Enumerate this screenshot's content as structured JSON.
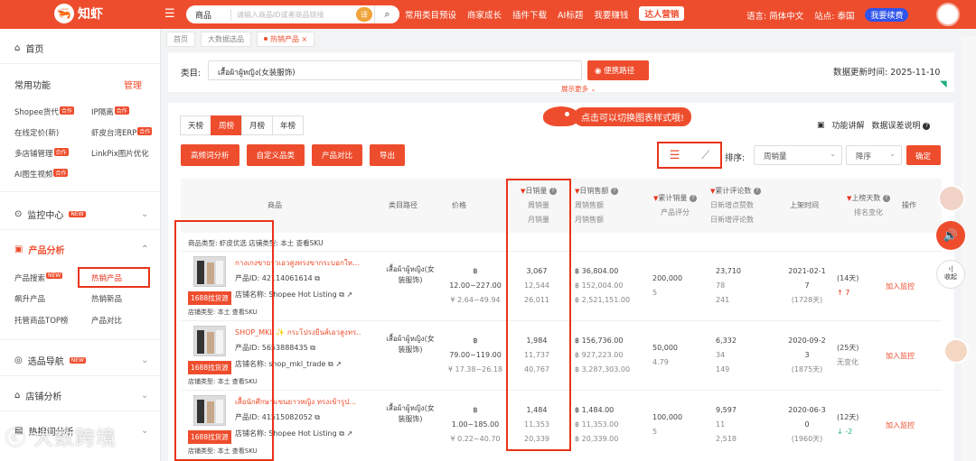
{
  "topbar": {
    "logo": "知虾",
    "search_type": "商品",
    "search_placeholder": "请输入商品ID或者商品链接",
    "translate_label": "译",
    "nav": [
      "常用类目预设",
      "商家成长",
      "插件下载",
      "AI标题",
      "我要赚钱"
    ],
    "sales_button": "达人营销",
    "language": "语言: 简体中文",
    "site": "站点: 泰国",
    "renew": "我要续费"
  },
  "sidebar": {
    "home": "首页",
    "common": "常用功能",
    "manage": "管理",
    "tools": [
      {
        "label": "Shopee货代",
        "tag": "合作"
      },
      {
        "label": "IP隔离",
        "tag": "合作"
      },
      {
        "label": "在线定价(新)",
        "tag": ""
      },
      {
        "label": "虾皮台湾ERP",
        "tag": "合作"
      },
      {
        "label": "多店铺管理",
        "tag": "合作"
      },
      {
        "label": "LinkPix图片优化",
        "tag": ""
      },
      {
        "label": "AI图生视频",
        "tag": "合作"
      }
    ],
    "monitor": "监控中心",
    "monitor_tag": "NEW",
    "product_analysis": "产品分析",
    "product_subs": [
      {
        "label": "产品搜索",
        "tag": "NEW"
      },
      {
        "label": "热销产品",
        "tag": ""
      },
      {
        "label": "飙升产品",
        "tag": ""
      },
      {
        "label": "热销新品",
        "tag": ""
      },
      {
        "label": "托管商品TOP榜",
        "tag": ""
      },
      {
        "label": "产品对比",
        "tag": ""
      }
    ],
    "selection": "选品导航",
    "selection_tag": "NEW",
    "shop_analysis": "店铺分析",
    "keyword_analysis": "热搜词分析",
    "watermark": "大数跨境"
  },
  "tabs": [
    "首页",
    "大数据选品",
    "热销产品"
  ],
  "category": {
    "label": "类目:",
    "value": "เสื้อผ้าผู้หญิง(女装服饰)",
    "shortcut": "便携路径",
    "update_label": "数据更新时间: 2025-11-10",
    "more": "展示更多"
  },
  "controls": {
    "periods": [
      "天榜",
      "周榜",
      "月榜",
      "年榜"
    ],
    "active_period": "周榜",
    "actions": [
      "高频词分析",
      "自定义品类",
      "产品对比",
      "导出"
    ],
    "tip": "点击可以切换图表样式哦!",
    "explain": "功能讲解",
    "error_note": "数据误差说明",
    "sort_label": "排序:",
    "sort_value": "周销量",
    "order_value": "降序",
    "confirm": "确定"
  },
  "table": {
    "headers": {
      "product": "商品",
      "path": "类目路径",
      "price": "价格",
      "sales": [
        "日销量",
        "周销量",
        "月销量"
      ],
      "revenue": [
        "日销售额",
        "周销售额",
        "月销售额"
      ],
      "total": [
        "累计销量",
        "产品评分"
      ],
      "reviews": [
        "累计评论数",
        "日新增点赞数",
        "日新增评论数"
      ],
      "listed": "上架时间",
      "rank": [
        "上榜天数",
        "排名变化"
      ],
      "op": "操作"
    },
    "partial_row": "商品类型: 虾皮优选  店铺类型: 本土  查看SKU",
    "rows": [
      {
        "name": "กางเกงขายาวเอวสูงทรงขากระบอกให...",
        "id": "产品ID: 42114061614",
        "shop": "店铺名称: Shopee Hot Listing",
        "shop_type": "店铺类型: 本土  查看SKU",
        "source": "1688找货源",
        "path": "เสื้อผ้าผู้หญิง(女装服饰)",
        "price": [
          "฿",
          "12.00~227.00",
          "¥ 2.64~49.94"
        ],
        "sales": [
          "3,067",
          "12,544",
          "26,011"
        ],
        "revenue": [
          "฿ 36,804.00",
          "฿ 152,004.00",
          "฿ 2,521,151.00"
        ],
        "total": [
          "200,000",
          "5"
        ],
        "reviews": [
          "23,710",
          "78",
          "241"
        ],
        "listed": [
          "2021-02-1",
          "7",
          "(1728天)"
        ],
        "rank": [
          "(14天)",
          "↑ 7"
        ],
        "rank_dir": "up",
        "op": "加入监控"
      },
      {
        "name": "SHOP_MKL ✨ กระโปรงยีนส์เอวสูงทร...",
        "id": "产品ID: 5653888435",
        "shop": "店铺名称: shop_mkl_trade",
        "shop_type": "店铺类型: 本土  查看SKU",
        "source": "1688找货源",
        "path": "เสื้อผ้าผู้หญิง(女装服饰)",
        "price": [
          "฿",
          "79.00~119.00",
          "¥ 17.38~26.18"
        ],
        "sales": [
          "1,984",
          "11,737",
          "40,767"
        ],
        "revenue": [
          "฿ 156,736.00",
          "฿ 927,223.00",
          "฿ 3,287,303.00"
        ],
        "total": [
          "50,000",
          "4.79"
        ],
        "reviews": [
          "6,332",
          "34",
          "149"
        ],
        "listed": [
          "2020-09-2",
          "3",
          "(1875天)"
        ],
        "rank": [
          "(25天)",
          "无变化"
        ],
        "rank_dir": "none",
        "op": "加入监控"
      },
      {
        "name": "เสื้อนักศึกษาแขนยาวหญิง ทรงเข้ารูป...",
        "id": "产品ID: 41515082052",
        "shop": "店铺名称: Shopee Hot Listing",
        "shop_type": "店铺类型: 本土  查看SKU",
        "source": "1688找货源",
        "path": "เสื้อผ้าผู้หญิง(女装服饰)",
        "price": [
          "฿",
          "1.00~185.00",
          "¥ 0.22~40.70"
        ],
        "sales": [
          "1,484",
          "11,353",
          "20,339"
        ],
        "revenue": [
          "฿ 1,484.00",
          "฿ 11,353.00",
          "฿ 20,339.00"
        ],
        "total": [
          "100,000",
          "5"
        ],
        "reviews": [
          "9,597",
          "11",
          "2,518"
        ],
        "listed": [
          "2020-06-3",
          "0",
          "(1960天)"
        ],
        "rank": [
          "(12天)",
          "↓ -2"
        ],
        "rank_dir": "down",
        "op": "加入监控"
      }
    ]
  },
  "floating": {
    "collapse": "收起"
  }
}
